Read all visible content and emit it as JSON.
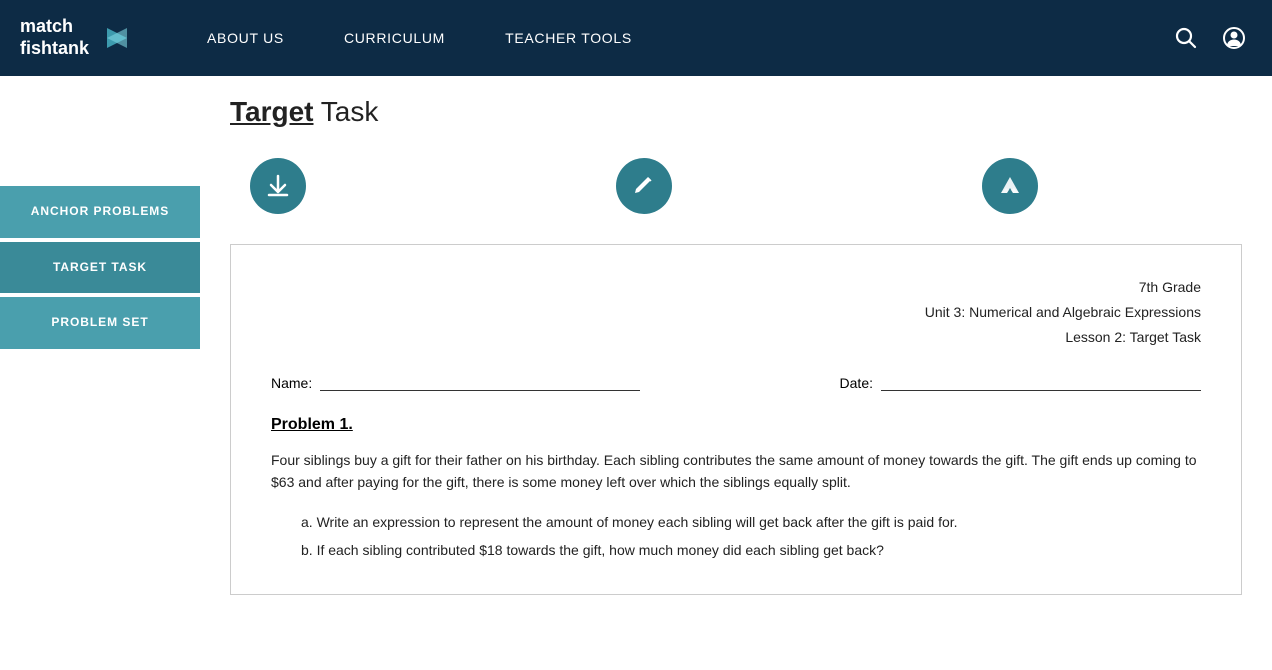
{
  "header": {
    "logo_line1": "match",
    "logo_line2": "fishtank",
    "nav_items": [
      "ABOUT US",
      "CURRICULUM",
      "TEACHER TOOLS"
    ]
  },
  "sidebar": {
    "items": [
      {
        "label": "ANCHOR\nPROBLEMS",
        "id": "anchor-problems"
      },
      {
        "label": "TARGET TASK",
        "id": "target-task",
        "active": true
      },
      {
        "label": "PROBLEM SET",
        "id": "problem-set"
      }
    ]
  },
  "page": {
    "title_underline": "Target",
    "title_rest": " Task",
    "action_download": "download",
    "action_edit": "edit",
    "action_drive": "drive"
  },
  "worksheet": {
    "grade": "7th Grade",
    "unit": "Unit 3: Numerical and Algebraic Expressions",
    "lesson": "Lesson 2: Target Task",
    "name_label": "Name:",
    "date_label": "Date:",
    "problem_title": "Problem 1.",
    "problem_text": "Four siblings buy a gift for their father on his birthday. Each sibling contributes the same amount of money towards the gift. The gift ends up coming to $63 and after paying for the gift, there is some money left over which the siblings equally split.",
    "sub_a": "a.  Write an expression to represent the amount of money each sibling will get back after the gift is paid for.",
    "sub_b": "b.  If each sibling contributed $18 towards the gift, how much money did each sibling get back?"
  }
}
